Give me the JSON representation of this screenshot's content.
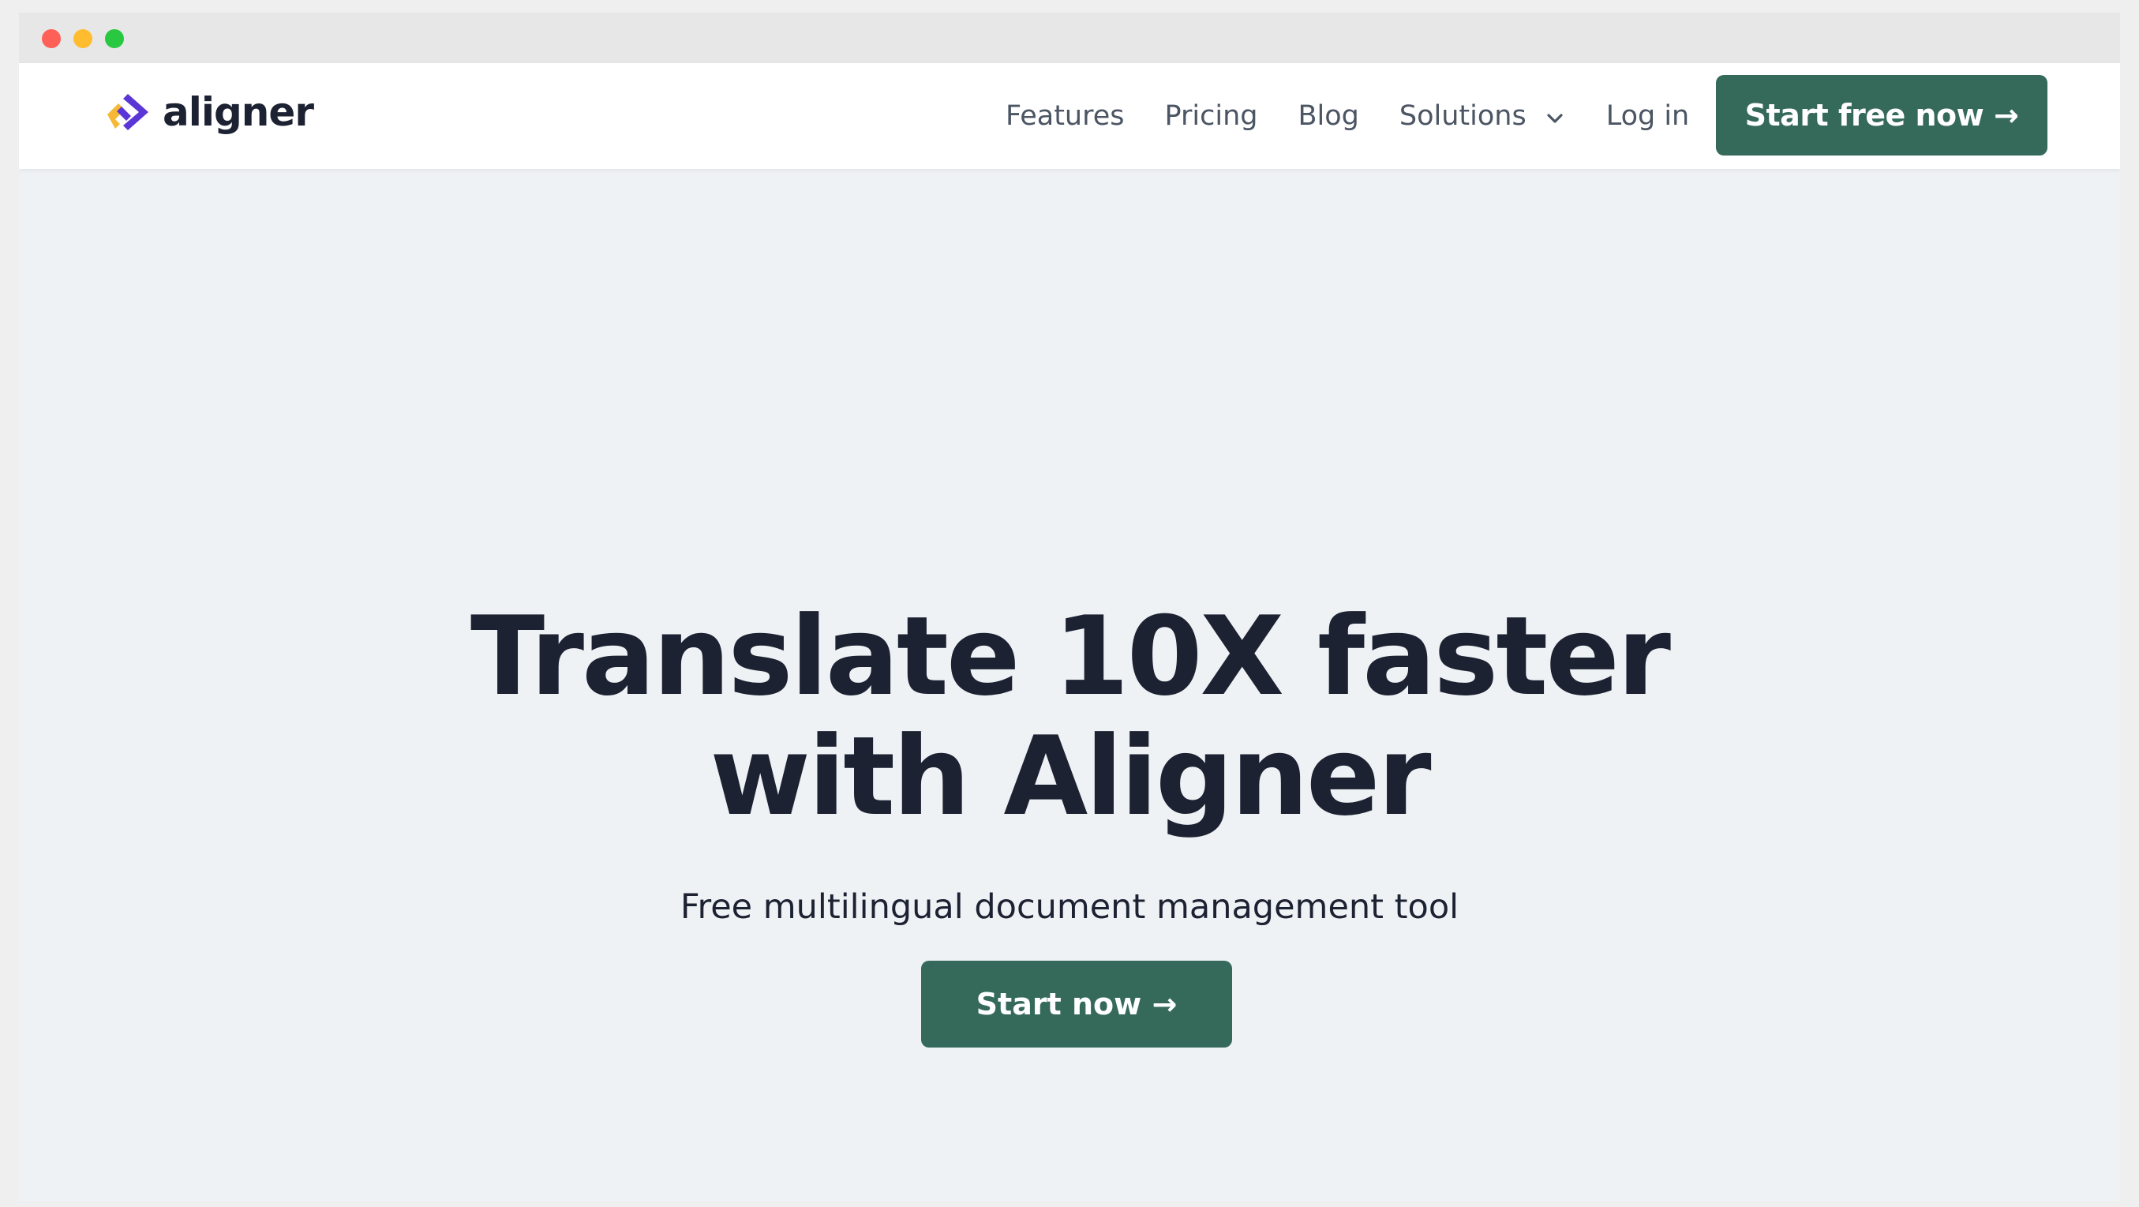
{
  "window": {
    "controls": [
      "close",
      "minimize",
      "maximize"
    ]
  },
  "nav": {
    "logo_text": "aligner",
    "links": [
      "Features",
      "Pricing",
      "Blog",
      "Solutions",
      "Log in"
    ],
    "cta_label": "Start free now →"
  },
  "hero": {
    "title_line1": "Translate 10X faster",
    "title_line2": "with Aligner",
    "subtitle": "Free multilingual document management tool",
    "cta_label": "Start now →"
  },
  "colors": {
    "primary": "#356a5b",
    "text_dark": "#1d2233",
    "nav_text": "#4b5563",
    "hero_bg": "#eef2f4",
    "logo_purple": "#5b36d6",
    "logo_yellow": "#f5b935"
  },
  "icons": {
    "logo": "aligner-logo-icon",
    "solutions_dropdown": "chevron-down-icon"
  }
}
